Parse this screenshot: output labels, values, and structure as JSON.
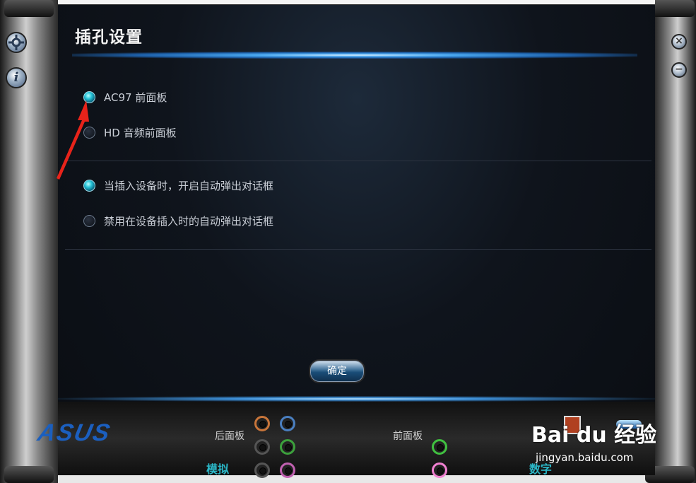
{
  "window": {
    "title": "插孔设置",
    "close_label": "×",
    "minimize_label": "−"
  },
  "side_buttons": {
    "settings_icon": "gear-icon",
    "info_label": "i"
  },
  "panel_type": {
    "options": [
      {
        "label": "AC97 前面板",
        "checked": true
      },
      {
        "label": "HD 音频前面板",
        "checked": false
      }
    ]
  },
  "popup": {
    "options": [
      {
        "label": "当插入设备时，开启自动弹出对话框",
        "checked": true
      },
      {
        "label": "禁用在设备插入时的自动弹出对话框",
        "checked": false
      }
    ]
  },
  "ok_button": "确定",
  "footer": {
    "logo": "ASUS",
    "rear_panel_label": "后面板",
    "front_panel_label": "前面板",
    "analog_label": "模拟",
    "digital_label": "数字",
    "jack_colors": {
      "orange": "#c8753a",
      "blue": "#4a7fc0",
      "black": "#555555",
      "green": "#3ca03c",
      "pink": "#c060b0",
      "front_green": "#40c040",
      "front_pink": "#f080d0"
    }
  },
  "watermark": {
    "brand": "Bai du 经验",
    "url": "jingyan.baidu.com"
  },
  "colors": {
    "accent_cyan": "#26c4d8",
    "title_glow": "#4aa8f0"
  }
}
